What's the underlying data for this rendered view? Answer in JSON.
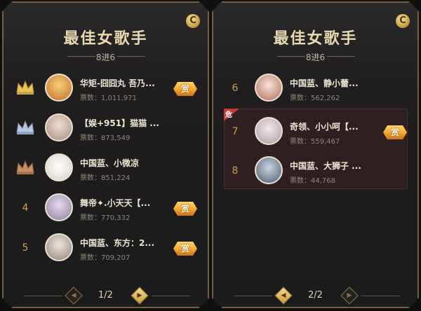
{
  "panels": [
    {
      "title": "最佳女歌手",
      "subtitle": "8进6",
      "coin_label": "C",
      "page": "1/2",
      "rows": [
        {
          "rank": "1",
          "medal": "gold",
          "name": "华矩-囧囧丸  吾乃...",
          "votes": "票数：1,011,971",
          "reward": "赏",
          "avatar_color": "#e7a54a"
        },
        {
          "rank": "2",
          "medal": "silver",
          "name": "【娱+951】猫猫 ...",
          "votes": "票数：873,549",
          "reward": "",
          "avatar_color": "#d6b8aa"
        },
        {
          "rank": "3",
          "medal": "bronze",
          "name": "中国蓝、小微凉",
          "votes": "票数：851,224",
          "reward": "",
          "avatar_color": "#f1ece7"
        },
        {
          "rank": "4",
          "medal": "",
          "name": "舞帝✦.小天天【...",
          "votes": "票数：770,332",
          "reward": "赏",
          "avatar_color": "#b9aec2"
        },
        {
          "rank": "5",
          "medal": "",
          "name": "中国蓝、东方：2...",
          "votes": "票数：709,207",
          "reward": "赏",
          "avatar_color": "#c9bcb2"
        }
      ]
    },
    {
      "title": "最佳女歌手",
      "subtitle": "8进6",
      "coin_label": "C",
      "page": "2/2",
      "danger_label": "危",
      "rows": [
        {
          "rank": "6",
          "medal": "",
          "name": "中国蓝、静小蕾...",
          "votes": "票数：562,262",
          "reward": "",
          "avatar_color": "#e3c3b8"
        },
        {
          "rank": "7",
          "medal": "",
          "name": "奇领、小小呵【...",
          "votes": "票数：559,467",
          "reward": "赏",
          "avatar_color": "#d7cfd2"
        },
        {
          "rank": "8",
          "medal": "",
          "name": "中国蓝、大狮子 ...",
          "votes": "票数：44,768",
          "reward": "",
          "avatar_color": "#7f8ca0"
        }
      ]
    }
  ],
  "colors": {
    "gold": "#e7c45a",
    "silver": "#b7c6de",
    "bronze": "#c98d66"
  }
}
